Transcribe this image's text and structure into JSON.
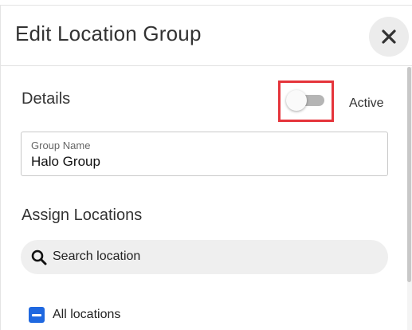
{
  "dialog": {
    "title": "Edit Location Group",
    "close_icon": "close-icon"
  },
  "details": {
    "heading": "Details",
    "active_toggle": {
      "label": "Active",
      "state": "off"
    },
    "group_name": {
      "label": "Group Name",
      "value": "Halo Group"
    }
  },
  "assign": {
    "heading": "Assign Locations",
    "search": {
      "placeholder": "Search location",
      "icon": "search-icon"
    },
    "all_locations": {
      "label": "All locations",
      "state": "indeterminate"
    }
  },
  "colors": {
    "accent": "#1f68e0",
    "highlight": "#e5343b",
    "toggle_off": "#b5b5b5"
  }
}
